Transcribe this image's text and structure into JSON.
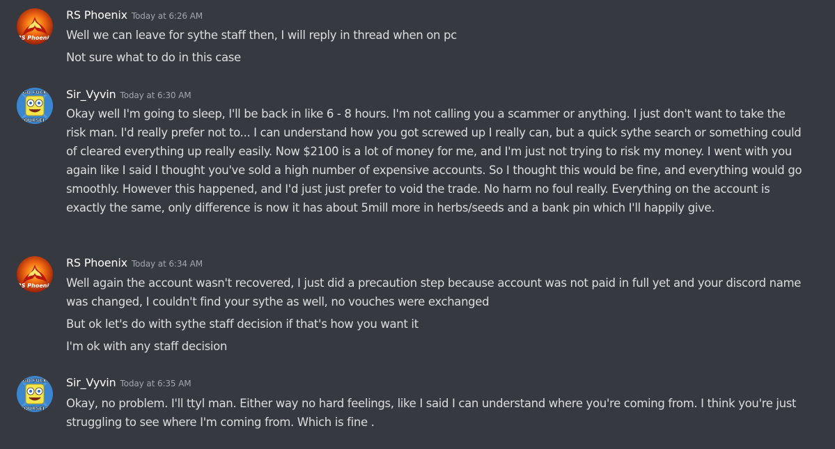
{
  "messages": [
    {
      "author": "RS Phoenix",
      "avatar_icon": "phoenix-avatar-icon",
      "timestamp": "Today at 6:26 AM",
      "lines": [
        "Well we can leave for sythe staff then, I will reply in thread when on pc",
        "Not sure what to do in this case"
      ]
    },
    {
      "author": "Sir_Vyvin",
      "avatar_icon": "spongebob-avatar-icon",
      "timestamp": "Today at 6:30 AM",
      "lines": [
        "Okay well I'm going to sleep, I'll be back in like 6 - 8 hours. I'm not calling you a scammer or anything. I just don't want to take the risk man. I'd really prefer not to... I can understand how you got screwed up I really can, but a quick sythe search or something could of cleared everything up really easily. Now $2100 is a lot of money for me, and I'm just not trying to risk my money. I went with you again like I said I thought you've sold a high number of expensive accounts. So I thought this would be fine, and everything would go smoothly. However this happened, and I'd just just prefer to void the trade. No harm no foul really. Everything on the account is exactly the same, only difference is now it has about 5mill more in herbs/seeds and a bank pin which I'll happily give."
      ]
    },
    {
      "author": "RS Phoenix",
      "avatar_icon": "phoenix-avatar-icon",
      "timestamp": "Today at 6:34 AM",
      "lines": [
        "Well again the account wasn't recovered, I just did a precaution step because account was not paid in full yet and your discord name was changed, I couldn't find your sythe as well, no vouches were exchanged",
        "But ok let's do with sythe staff decision if that's how you want it",
        "I'm ok with any staff decision"
      ]
    },
    {
      "author": "Sir_Vyvin",
      "avatar_icon": "spongebob-avatar-icon",
      "timestamp": "Today at 6:35 AM",
      "lines": [
        "Okay, no problem. I'll ttyl man. Either way no hard feelings, like I said I can understand where you're coming from. I think you're just struggling to see where I'm coming from. Which is fine ."
      ]
    }
  ],
  "avatar_text": {
    "phoenix": "RS Phoenix",
    "spongebob_top": "GO FUCK",
    "spongebob_bottom": "YOURSELF"
  },
  "colors": {
    "background": "#36393f",
    "username": "#ffffff",
    "timestamp": "#a3a6aa",
    "message_text": "#dcddde"
  }
}
